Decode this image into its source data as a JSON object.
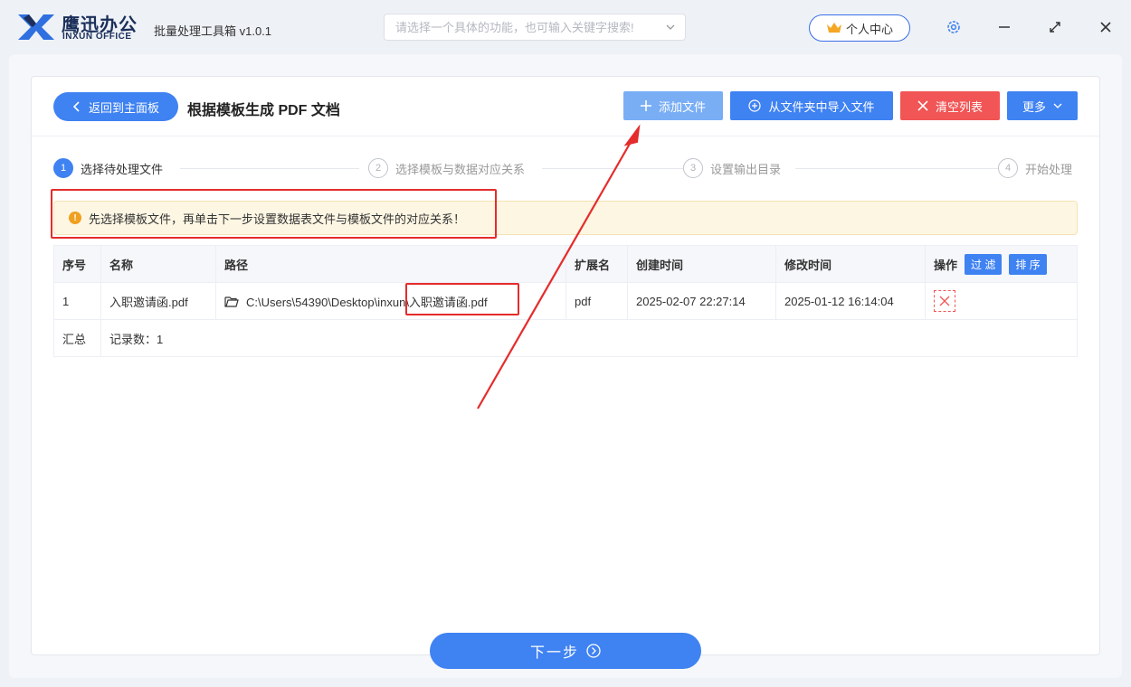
{
  "titlebar": {
    "brand_cn": "鹰迅办公",
    "brand_en": "INXUN OFFICE",
    "app_title": "批量处理工具箱 v1.0.1",
    "search_placeholder": "请选择一个具体的功能，也可输入关键字搜索!",
    "user_center": "个人中心"
  },
  "toolbar": {
    "back_label": "返回到主面板",
    "page_title": "根据模板生成 PDF 文档",
    "add_file": "添加文件",
    "import_folder": "从文件夹中导入文件",
    "clear_list": "清空列表",
    "more": "更多"
  },
  "steps": [
    {
      "num": "1",
      "label": "选择待处理文件",
      "active": true
    },
    {
      "num": "2",
      "label": "选择模板与数据对应关系",
      "active": false
    },
    {
      "num": "3",
      "label": "设置输出目录",
      "active": false
    },
    {
      "num": "4",
      "label": "开始处理",
      "active": false
    }
  ],
  "alert": {
    "text": "先选择模板文件，再单击下一步设置数据表文件与模板文件的对应关系！"
  },
  "table": {
    "headers": [
      "序号",
      "名称",
      "路径",
      "扩展名",
      "创建时间",
      "修改时间",
      "操作"
    ],
    "filter_label": "过 滤",
    "sort_label": "排 序",
    "rows": [
      {
        "index": "1",
        "name": "入职邀请函.pdf",
        "path": "C:\\Users\\54390\\Desktop\\inxun\\入职邀请函.pdf",
        "ext": "pdf",
        "created": "2025-02-07 22:27:14",
        "modified": "2025-01-12 16:14:04"
      }
    ],
    "summary_label": "汇总",
    "summary_text": "记录数：1"
  },
  "footer": {
    "next_label": "下一步"
  },
  "colors": {
    "primary": "#3f82f2",
    "danger": "#f15555",
    "annotation": "#e52c2c"
  }
}
